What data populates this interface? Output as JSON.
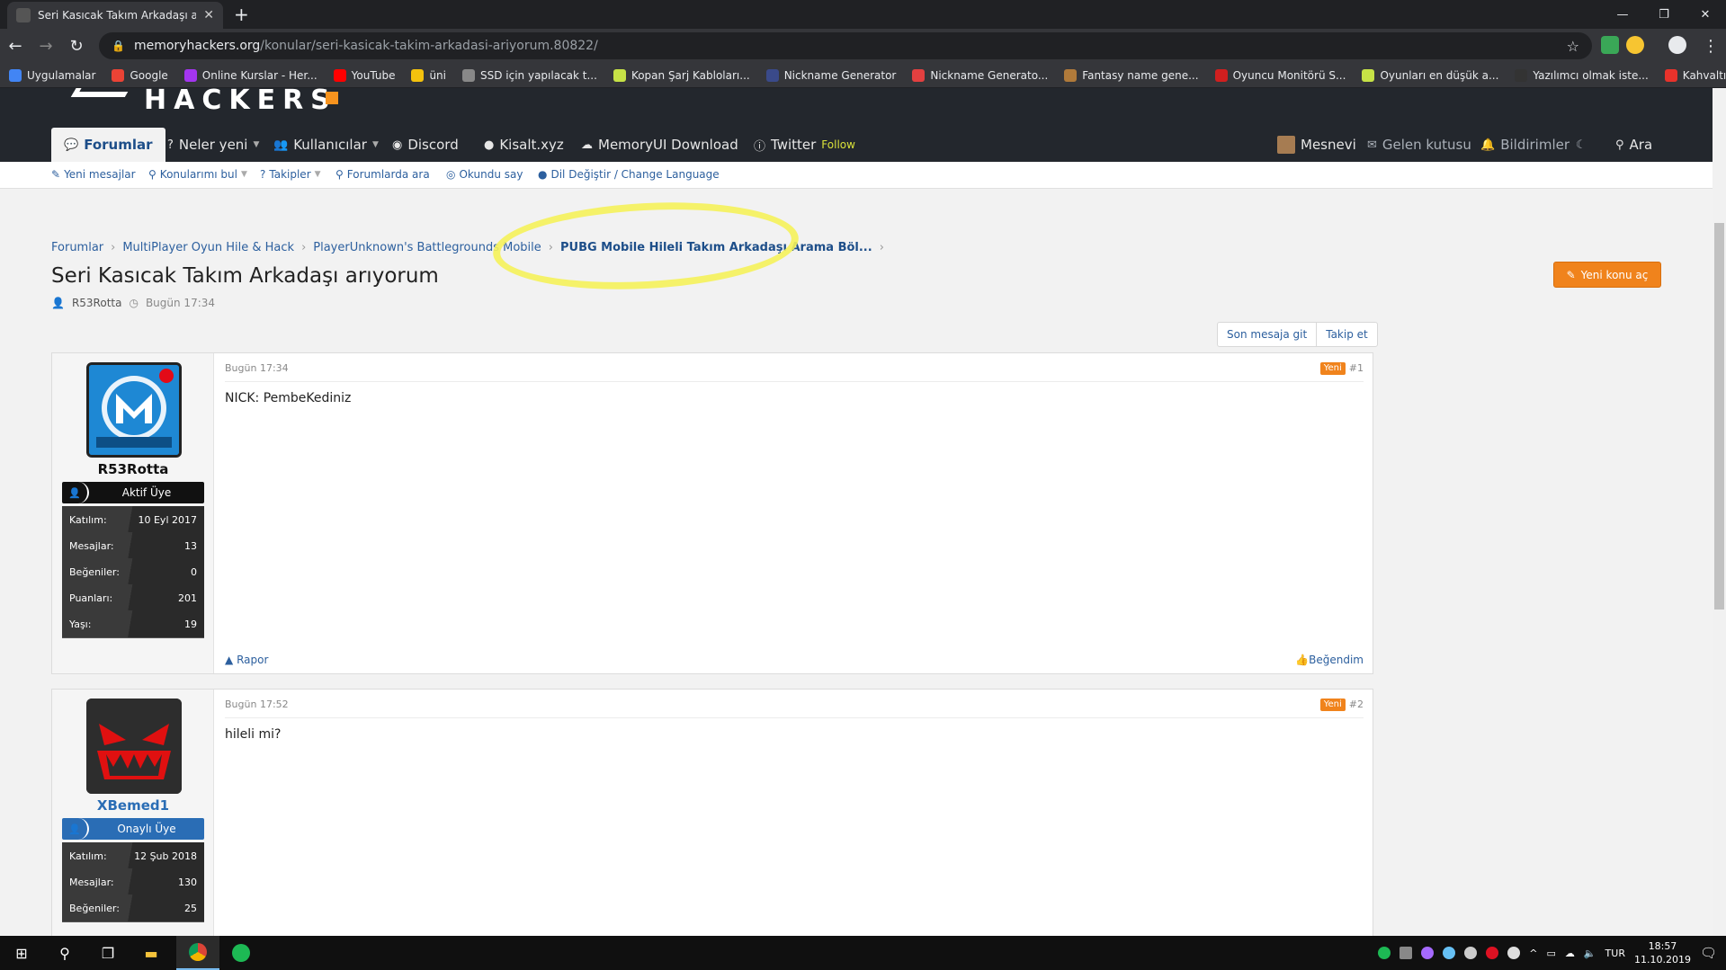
{
  "browser": {
    "tab_title": "Seri Kasıcak Takım Arkadaşı arıyo",
    "url_host": "memoryhackers.org",
    "url_path": "/konular/seri-kasicak-takim-arkadasi-ariyorum.80822/",
    "bookmarks": [
      {
        "label": "Uygulamalar",
        "color": "#4285f4"
      },
      {
        "label": "Google",
        "color": "#ea4335"
      },
      {
        "label": "Online Kurslar - Her...",
        "color": "#a435f0"
      },
      {
        "label": "YouTube",
        "color": "#ff0000"
      },
      {
        "label": "üni",
        "color": "#f4c20d"
      },
      {
        "label": "SSD için yapılacak t...",
        "color": "#888888"
      },
      {
        "label": "Kopan Şarj Kabloları...",
        "color": "#c6e246"
      },
      {
        "label": "Nickname Generator",
        "color": "#3a4a8a"
      },
      {
        "label": "Nickname Generato...",
        "color": "#e34040"
      },
      {
        "label": "Fantasy name gene...",
        "color": "#b07a3a"
      },
      {
        "label": "Oyuncu Monitörü S...",
        "color": "#d11f1f"
      },
      {
        "label": "Oyunları en düşük a...",
        "color": "#c6e246"
      },
      {
        "label": "Yazılımcı olmak iste...",
        "color": "#333333"
      },
      {
        "label": "Kahvaltılık Krep Tari...",
        "color": "#e8322b"
      }
    ]
  },
  "site": {
    "logo_text": "HACKERS",
    "nav": {
      "forums": "Forumlar",
      "whats_new": "Neler yeni",
      "members": "Kullanıcılar",
      "discord": "Discord",
      "kisalt": "Kisalt.xyz",
      "memoryui": "MemoryUI Download",
      "twitter": "Twitter",
      "follow": "Follow",
      "user": "Mesnevi",
      "inbox": "Gelen kutusu",
      "alerts": "Bildirimler",
      "search": "Ara"
    },
    "subnav": {
      "new_posts": "Yeni mesajlar",
      "find_threads": "Konularımı bul",
      "watched": "Takipler",
      "search_forums": "Forumlarda ara",
      "mark_read": "Okundu say",
      "language": "Dil Değiştir / Change Language"
    }
  },
  "breadcrumb": [
    "Forumlar",
    "MultiPlayer Oyun Hile & Hack",
    "PlayerUnknown's Battlegrounds Mobile",
    "PUBG Mobile Hileli Takım Arkadaşı Arama Böl..."
  ],
  "thread": {
    "title": "Seri Kasıcak Takım Arkadaşı arıyorum",
    "author": "R53Rotta",
    "time": "Bugün 17:34",
    "new_thread_button": "Yeni konu aç",
    "last_post_button": "Son mesaja git",
    "watch_button": "Takip et"
  },
  "posts": [
    {
      "username": "R53Rotta",
      "role": "Aktif Üye",
      "role_color": "#111111",
      "stats": [
        {
          "label": "Katılım:",
          "value": "10 Eyl 2017"
        },
        {
          "label": "Mesajlar:",
          "value": "13"
        },
        {
          "label": "Beğeniler:",
          "value": "0"
        },
        {
          "label": "Puanları:",
          "value": "201"
        },
        {
          "label": "Yaşı:",
          "value": "19"
        }
      ],
      "time": "Bugün 17:34",
      "new_badge": "Yeni",
      "number": "#1",
      "text": "NICK: PembeKediniz",
      "report": "Rapor",
      "like": "Beğendim"
    },
    {
      "username": "XBemed1",
      "role": "Onaylı Üye",
      "role_color": "#2a6db5",
      "stats": [
        {
          "label": "Katılım:",
          "value": "12 Şub 2018"
        },
        {
          "label": "Mesajlar:",
          "value": "130"
        },
        {
          "label": "Beğeniler:",
          "value": "25"
        }
      ],
      "time": "Bugün 17:52",
      "new_badge": "Yeni",
      "number": "#2",
      "text": "hileli mi?"
    }
  ],
  "taskbar": {
    "lang": "TUR",
    "time": "18:57",
    "date": "11.10.2019"
  }
}
